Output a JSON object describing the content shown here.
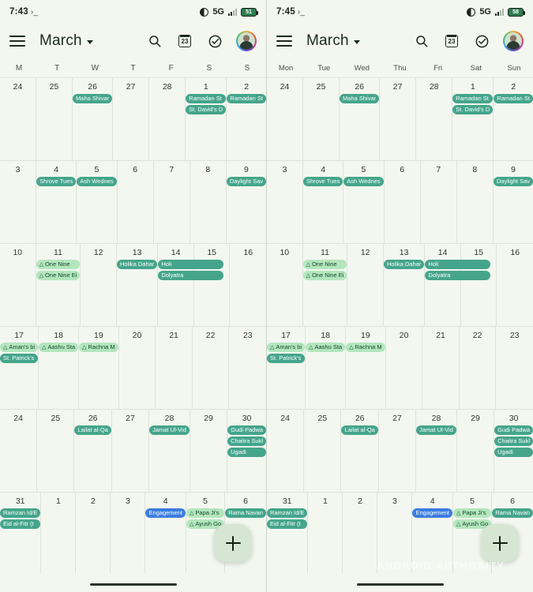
{
  "panels": [
    {
      "id": "left",
      "status": {
        "time": "7:43",
        "terminal": "›_",
        "network": "5G",
        "battery": "51"
      },
      "toolbar": {
        "menu": "menu-icon",
        "month": "March",
        "search": "search-icon",
        "today": "23",
        "tasks": "check-circle-icon",
        "avatar": "profile-avatar"
      },
      "weekdays": [
        "M",
        "T",
        "W",
        "T",
        "F",
        "S",
        "S"
      ]
    },
    {
      "id": "right",
      "status": {
        "time": "7:45",
        "terminal": "›_",
        "network": "5G",
        "battery": "58"
      },
      "toolbar": {
        "menu": "menu-icon",
        "month": "March",
        "search": "search-icon",
        "today": "23",
        "tasks": "check-circle-icon",
        "avatar": "profile-avatar"
      },
      "weekdays": [
        "Mon",
        "Tue",
        "Wed",
        "Thu",
        "Fri",
        "Sat",
        "Sun"
      ]
    }
  ],
  "weeks": [
    [
      {
        "num": "24",
        "events": []
      },
      {
        "num": "25",
        "events": []
      },
      {
        "num": "26",
        "events": [
          {
            "title": "Maha Shivar",
            "type": "holiday"
          }
        ]
      },
      {
        "num": "27",
        "events": []
      },
      {
        "num": "28",
        "events": []
      },
      {
        "num": "1",
        "events": [
          {
            "title": "Ramadan St",
            "type": "holiday"
          },
          {
            "title": "St. David's D",
            "type": "holiday"
          }
        ]
      },
      {
        "num": "2",
        "events": [
          {
            "title": "Ramadan St",
            "type": "holiday"
          }
        ]
      }
    ],
    [
      {
        "num": "3",
        "events": []
      },
      {
        "num": "4",
        "events": [
          {
            "title": "Shrove Tues",
            "type": "holiday"
          }
        ]
      },
      {
        "num": "5",
        "events": [
          {
            "title": "Ash Wednes",
            "type": "holiday"
          }
        ]
      },
      {
        "num": "6",
        "events": []
      },
      {
        "num": "7",
        "events": []
      },
      {
        "num": "8",
        "events": []
      },
      {
        "num": "9",
        "events": [
          {
            "title": "Daylight Sav",
            "type": "holiday"
          }
        ]
      }
    ],
    [
      {
        "num": "10",
        "events": []
      },
      {
        "num": "11",
        "events": [
          {
            "title": "One Nine",
            "type": "birthday"
          },
          {
            "title": "One Nine Ei",
            "type": "birthday"
          }
        ]
      },
      {
        "num": "12",
        "events": []
      },
      {
        "num": "13",
        "events": [
          {
            "title": "Holika Dahar",
            "type": "holiday"
          }
        ]
      },
      {
        "num": "14",
        "events": [
          {
            "title": "Holi",
            "type": "holiday",
            "span": true
          },
          {
            "title": "Dolyatra",
            "type": "holiday",
            "span": true
          }
        ]
      },
      {
        "num": "15",
        "events": []
      },
      {
        "num": "16",
        "events": []
      }
    ],
    [
      {
        "num": "17",
        "events": [
          {
            "title": "Aman's bi",
            "type": "birthday"
          },
          {
            "title": "St. Patrick's",
            "type": "holiday"
          }
        ]
      },
      {
        "num": "18",
        "events": [
          {
            "title": "Aashu Sta",
            "type": "birthday"
          }
        ]
      },
      {
        "num": "19",
        "events": [
          {
            "title": "Rachna M",
            "type": "birthday"
          }
        ]
      },
      {
        "num": "20",
        "events": []
      },
      {
        "num": "21",
        "events": []
      },
      {
        "num": "22",
        "events": []
      },
      {
        "num": "23",
        "events": []
      }
    ],
    [
      {
        "num": "24",
        "events": []
      },
      {
        "num": "25",
        "events": []
      },
      {
        "num": "26",
        "events": [
          {
            "title": "Lailat al-Qa",
            "type": "holiday"
          }
        ]
      },
      {
        "num": "27",
        "events": []
      },
      {
        "num": "28",
        "events": [
          {
            "title": "Jamat Ul-Vid",
            "type": "holiday"
          }
        ]
      },
      {
        "num": "29",
        "events": []
      },
      {
        "num": "30",
        "events": [
          {
            "title": "Gudi Padwa",
            "type": "holiday"
          },
          {
            "title": "Chaitra Sukl",
            "type": "holiday"
          },
          {
            "title": "Ugadi",
            "type": "holiday"
          }
        ]
      }
    ],
    [
      {
        "num": "31",
        "events": [
          {
            "title": "Ramzan Id/E",
            "type": "holiday"
          },
          {
            "title": "Eid al-Fitr (t",
            "type": "holiday"
          }
        ]
      },
      {
        "num": "1",
        "events": []
      },
      {
        "num": "2",
        "events": []
      },
      {
        "num": "3",
        "events": []
      },
      {
        "num": "4",
        "events": [
          {
            "title": "Engagement",
            "type": "personal"
          }
        ]
      },
      {
        "num": "5",
        "events": [
          {
            "title": "Papa Ji's",
            "type": "birthday"
          },
          {
            "title": "Ayush Go",
            "type": "birthday"
          }
        ]
      },
      {
        "num": "6",
        "events": [
          {
            "title": "Rama Navan",
            "type": "holiday"
          }
        ]
      }
    ]
  ],
  "fab": {
    "label": "+",
    "name": "create-event-button"
  },
  "watermark": "ANDROID AUTHORITY",
  "colors": {
    "holiday": "#45a58c",
    "birthday": "#b4e6bd",
    "personal": "#3b7de0",
    "background": "#f3f7f0"
  }
}
